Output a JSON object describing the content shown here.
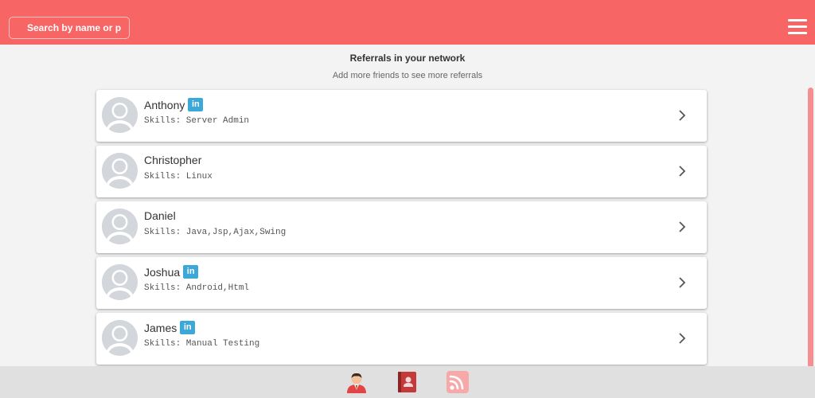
{
  "search": {
    "placeholder": "Search by name or p"
  },
  "header": {
    "title": "Referrals in your network",
    "subtitle": "Add more friends to see more referrals"
  },
  "li_label": "in",
  "referrals": [
    {
      "name": "Anthony",
      "skills": "Skills: Server Admin",
      "linkedin": true
    },
    {
      "name": "Christopher",
      "skills": "Skills: Linux",
      "linkedin": false
    },
    {
      "name": "Daniel",
      "skills": "Skills: Java,Jsp,Ajax,Swing",
      "linkedin": false
    },
    {
      "name": "Joshua",
      "skills": "Skills: Android,Html",
      "linkedin": true
    },
    {
      "name": "James",
      "skills": "Skills: Manual Testing",
      "linkedin": true
    }
  ],
  "bottom_tabs": [
    {
      "icon": "person-icon"
    },
    {
      "icon": "contact-book-icon"
    },
    {
      "icon": "rss-feed-icon"
    }
  ],
  "colors": {
    "brand": "#f76665",
    "linkedin": "#3ba8d8",
    "scrollbar": "#f58e8e"
  }
}
